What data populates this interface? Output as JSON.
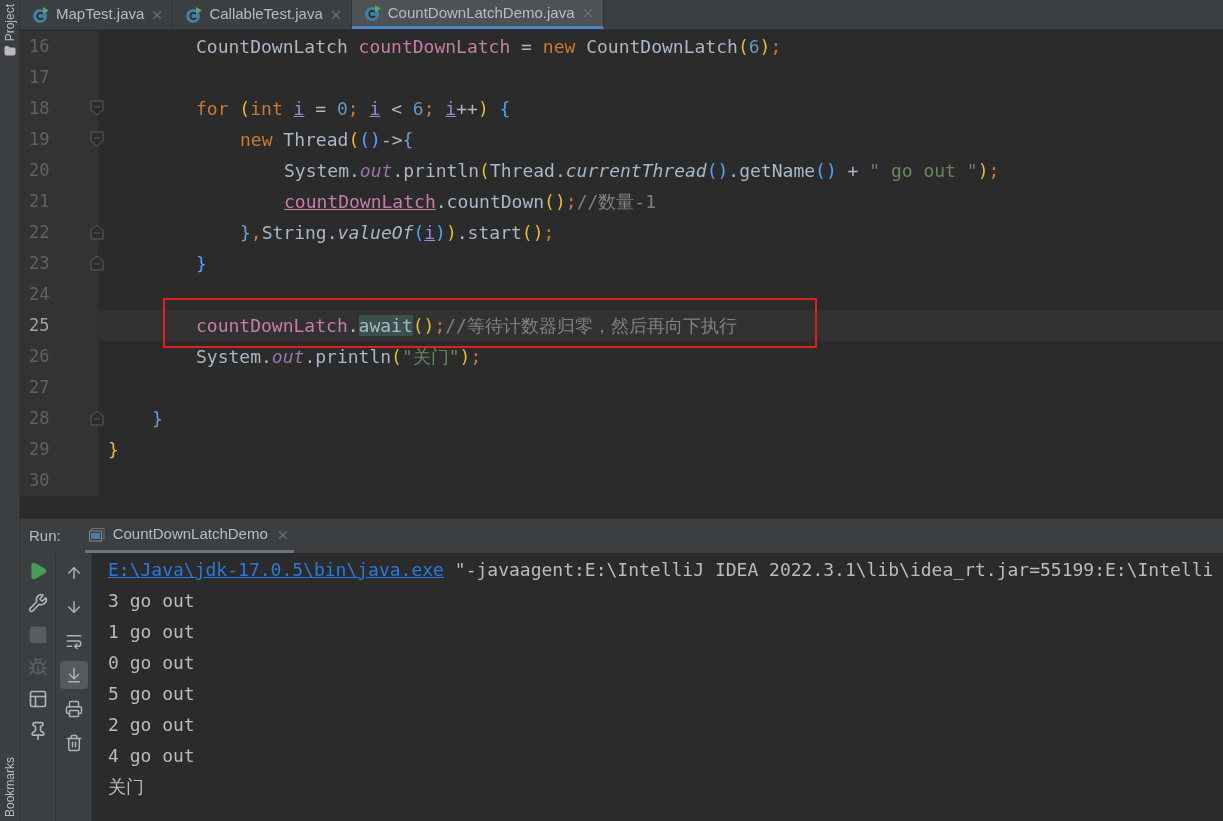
{
  "side_labels": {
    "top": "Project",
    "bottom": "Bookmarks"
  },
  "tabs": [
    {
      "label": "MapTest.java",
      "selected": false
    },
    {
      "label": "CallableTest.java",
      "selected": false
    },
    {
      "label": "CountDownLatchDemo.java",
      "selected": true
    }
  ],
  "editor": {
    "lines": [
      {
        "children": [
          {
            "children": [
              {
                "number": "16",
                "current": false,
                "boxed": false,
                "tokens": [
                  {
                    "t": "CountDownLatch ",
                    "kind": "plain"
                  },
                  {
                    "t": "countDownLatch",
                    "kind": "var"
                  },
                  {
                    "t": " = ",
                    "kind": "plain"
                  },
                  {
                    "t": "new ",
                    "kind": "keyword"
                  },
                  {
                    "t": "CountDownLatch",
                    "kind": "plain"
                  },
                  {
                    "t": "(",
                    "kind": "paren1"
                  },
                  {
                    "t": "6",
                    "kind": "number"
                  },
                  {
                    "t": ")",
                    "kind": "paren1"
                  },
                  {
                    "t": ";",
                    "kind": "keyword"
                  }
                ]
              },
              {
                "number": "17",
                "current": false,
                "boxed": false
              },
              {
                "number": "18",
                "current": false,
                "boxed": false,
                "fold_marker": {
                  "kind": "open"
                },
                "tokens": [
                  {
                    "t": "for ",
                    "kind": "keyword"
                  },
                  {
                    "t": "(",
                    "kind": "paren1"
                  },
                  {
                    "t": "int ",
                    "kind": "keyword"
                  },
                  {
                    "t": "i",
                    "kind": "loopvar"
                  },
                  {
                    "t": " = ",
                    "kind": "plain"
                  },
                  {
                    "t": "0",
                    "kind": "number"
                  },
                  {
                    "t": "; ",
                    "kind": "keyword"
                  },
                  {
                    "t": "i",
                    "kind": "loopvar"
                  },
                  {
                    "t": " < ",
                    "kind": "plain"
                  },
                  {
                    "t": "6",
                    "kind": "number"
                  },
                  {
                    "t": "; ",
                    "kind": "keyword"
                  },
                  {
                    "t": "i",
                    "kind": "loopvar"
                  },
                  {
                    "t": "++",
                    "kind": "plain"
                  },
                  {
                    "t": ")",
                    "kind": "paren1"
                  },
                  {
                    "t": " {",
                    "kind": "paren2"
                  }
                ],
                "children": [
                  {
                    "number": "19",
                    "current": false,
                    "boxed": false,
                    "fold_marker": {
                      "kind": "open"
                    },
                    "tokens": [
                      {
                        "t": "new ",
                        "kind": "keyword"
                      },
                      {
                        "t": "Thread",
                        "kind": "plain"
                      },
                      {
                        "t": "(",
                        "kind": "paren1"
                      },
                      {
                        "t": "()",
                        "kind": "paren2"
                      },
                      {
                        "t": "->",
                        "kind": "plain"
                      },
                      {
                        "t": "{",
                        "kind": "paren3"
                      }
                    ],
                    "children": [
                      {
                        "number": "20",
                        "current": false,
                        "boxed": false,
                        "tokens": [
                          {
                            "t": "System.",
                            "kind": "plain"
                          },
                          {
                            "t": "out",
                            "kind": "static"
                          },
                          {
                            "t": ".println",
                            "kind": "plain"
                          },
                          {
                            "t": "(",
                            "kind": "paren1"
                          },
                          {
                            "t": "Thread.",
                            "kind": "plain"
                          },
                          {
                            "t": "currentThread",
                            "kind": "italic"
                          },
                          {
                            "t": "()",
                            "kind": "paren2"
                          },
                          {
                            "t": ".getName",
                            "kind": "plain"
                          },
                          {
                            "t": "()",
                            "kind": "paren2"
                          },
                          {
                            "t": " + ",
                            "kind": "plain"
                          },
                          {
                            "t": "\" go out \"",
                            "kind": "string"
                          },
                          {
                            "t": ")",
                            "kind": "paren1"
                          },
                          {
                            "t": ";",
                            "kind": "keyword"
                          }
                        ]
                      },
                      {
                        "number": "21",
                        "current": false,
                        "boxed": false,
                        "tokens": [
                          {
                            "t": "countDownLatch",
                            "kind": "varunder"
                          },
                          {
                            "t": ".countDown",
                            "kind": "plain"
                          },
                          {
                            "t": "()",
                            "kind": "paren1"
                          },
                          {
                            "t": ";",
                            "kind": "keyword"
                          },
                          {
                            "t": "//数量-1",
                            "kind": "comment"
                          }
                        ]
                      }
                    ]
                  },
                  {
                    "number": "22",
                    "current": false,
                    "boxed": false,
                    "fold_marker": {
                      "kind": "close"
                    },
                    "tokens": [
                      {
                        "t": "}",
                        "kind": "paren3"
                      },
                      {
                        "t": ",",
                        "kind": "keyword"
                      },
                      {
                        "t": "String.",
                        "kind": "plain"
                      },
                      {
                        "t": "valueOf",
                        "kind": "italic"
                      },
                      {
                        "t": "(",
                        "kind": "paren2"
                      },
                      {
                        "t": "i",
                        "kind": "loopvar"
                      },
                      {
                        "t": ")",
                        "kind": "paren2"
                      },
                      {
                        "t": ")",
                        "kind": "paren1"
                      },
                      {
                        "t": ".start",
                        "kind": "plain"
                      },
                      {
                        "t": "()",
                        "kind": "paren1"
                      },
                      {
                        "t": ";",
                        "kind": "keyword"
                      }
                    ]
                  }
                ]
              },
              {
                "number": "23",
                "current": false,
                "boxed": false,
                "fold_marker": {
                  "kind": "close"
                },
                "tokens": [
                  {
                    "t": "}",
                    "kind": "paren2"
                  }
                ]
              },
              {
                "number": "24",
                "current": false,
                "boxed": false
              },
              {
                "number": "25",
                "current": true,
                "boxed": true,
                "tokens": [
                  {
                    "t": "countDownLatch",
                    "kind": "var"
                  },
                  {
                    "t": ".",
                    "kind": "plain"
                  },
                  {
                    "t": "await",
                    "kind": "match"
                  },
                  {
                    "t": "()",
                    "kind": "paren1"
                  },
                  {
                    "t": ";",
                    "kind": "keyword"
                  },
                  {
                    "t": "//等待计数器归零，然后再向下执行",
                    "kind": "comment"
                  }
                ]
              },
              {
                "number": "26",
                "current": false,
                "boxed": false,
                "tokens": [
                  {
                    "t": "System.",
                    "kind": "plain"
                  },
                  {
                    "t": "out",
                    "kind": "static"
                  },
                  {
                    "t": ".println",
                    "kind": "plain"
                  },
                  {
                    "t": "(",
                    "kind": "paren1"
                  },
                  {
                    "t": "\"关门\"",
                    "kind": "string"
                  },
                  {
                    "t": ")",
                    "kind": "paren1"
                  },
                  {
                    "t": ";",
                    "kind": "keyword"
                  }
                ]
              },
              {
                "number": "27",
                "current": false,
                "boxed": false
              }
            ]
          },
          {
            "number": "28",
            "current": false,
            "boxed": false,
            "fold_marker": {
              "kind": "close"
            },
            "tokens": [
              {
                "t": "}",
                "kind": "paren3"
              }
            ]
          }
        ]
      },
      {
        "number": "29",
        "current": false,
        "boxed": false,
        "tokens": [
          {
            "t": "}",
            "kind": "paren1"
          }
        ]
      },
      {
        "number": "30",
        "current": false,
        "boxed": false
      }
    ]
  },
  "run_panel": {
    "label": "Run:",
    "tab": "CountDownLatchDemo",
    "left_tools": [
      {
        "disabled": false
      },
      {
        "disabled": false
      },
      {
        "disabled": true
      },
      {
        "disabled": true
      },
      {
        "disabled": false
      },
      {
        "disabled": false
      }
    ],
    "right_tools": [
      {
        "selected": false
      },
      {
        "selected": false
      },
      {
        "selected": false
      },
      {
        "selected": true
      },
      {
        "selected": false
      },
      {
        "selected": false
      }
    ],
    "console": [
      [
        {
          "t": "E:\\Java\\jdk-17.0.5\\bin\\java.exe",
          "kind": "link"
        },
        {
          "t": " \"-javaagent:E:\\IntelliJ IDEA 2022.3.1\\lib\\idea_rt.jar=55199:E:\\Intelli",
          "kind": "plain"
        }
      ],
      [
        {
          "t": "3 go out",
          "kind": "plain"
        }
      ],
      [
        {
          "t": "1 go out",
          "kind": "plain"
        }
      ],
      [
        {
          "t": "0 go out",
          "kind": "plain"
        }
      ],
      [
        {
          "t": "5 go out",
          "kind": "plain"
        }
      ],
      [
        {
          "t": "2 go out",
          "kind": "plain"
        }
      ],
      [
        {
          "t": "4 go out",
          "kind": "plain"
        }
      ],
      [
        {
          "t": "关门",
          "kind": "plain"
        }
      ]
    ]
  }
}
